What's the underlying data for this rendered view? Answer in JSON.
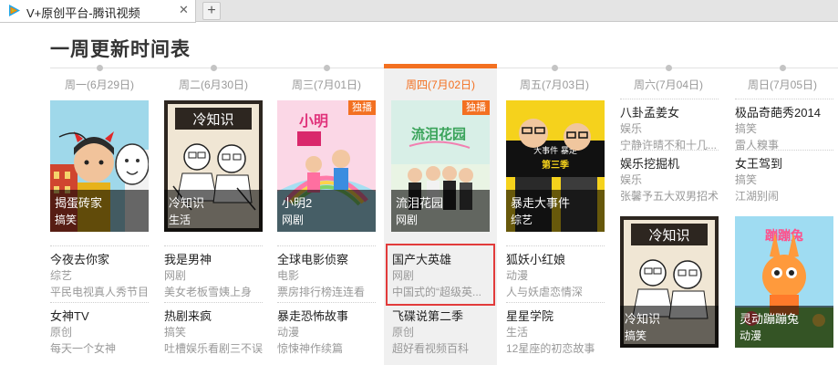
{
  "browser": {
    "tab_title": "V+原创平台-腾讯视频",
    "close_glyph": "✕",
    "newtab_glyph": "+"
  },
  "page": {
    "title": "一周更新时间表"
  },
  "colors": {
    "accent": "#f37021",
    "highlight": "#e23b3b"
  },
  "days": [
    {
      "label": "周一(6月29日)",
      "poster": {
        "title": "揭蛋砖家",
        "sub": "搞笑",
        "exclusive": ""
      },
      "entries": [
        {
          "title": "今夜去你家",
          "tag": "综艺",
          "desc": "平民电视真人秀节目"
        },
        {
          "title": "女神TV",
          "tag": "原创",
          "desc": "每天一个女神"
        }
      ]
    },
    {
      "label": "周二(6月30日)",
      "poster": {
        "title": "冷知识",
        "sub": "生活",
        "exclusive": ""
      },
      "entries": [
        {
          "title": "我是男神",
          "tag": "网剧",
          "desc": "美女老板雪姨上身"
        },
        {
          "title": "热剧来疯",
          "tag": "搞笑",
          "desc": "吐槽娱乐看剧三不误"
        }
      ]
    },
    {
      "label": "周三(7月01日)",
      "poster": {
        "title": "小明2",
        "sub": "网剧",
        "exclusive": "独播"
      },
      "entries": [
        {
          "title": "全球电影侦察",
          "tag": "电影",
          "desc": "票房排行榜连连看"
        },
        {
          "title": "暴走恐怖故事",
          "tag": "动漫",
          "desc": "惊悚神作续篇"
        }
      ]
    },
    {
      "label": "周四(7月02日)",
      "active": true,
      "poster": {
        "title": "流泪花园",
        "sub": "网剧",
        "exclusive": "独播"
      },
      "entries": [
        {
          "title": "国产大英雄",
          "tag": "网剧",
          "desc": "中国式的“超级英..."
        },
        {
          "title": "飞碟说第二季",
          "tag": "原创",
          "desc": "超好看视频百科"
        }
      ]
    },
    {
      "label": "周五(7月03日)",
      "poster": {
        "title": "暴走大事件",
        "sub": "综艺",
        "exclusive": ""
      },
      "entries": [
        {
          "title": "狐妖小红娘",
          "tag": "动漫",
          "desc": "人与妖虐恋情深"
        },
        {
          "title": "星星学院",
          "tag": "生活",
          "desc": "12星座的初恋故事"
        }
      ]
    },
    {
      "label": "周六(7月04日)",
      "entries": [
        {
          "title": "八卦孟姜女",
          "tag": "娱乐",
          "desc": "宁静许晴不和十几..."
        },
        {
          "title": "娱乐挖掘机",
          "tag": "娱乐",
          "desc": "张馨予五大双男招术"
        }
      ],
      "poster": {
        "title": "冷知识",
        "sub": "搞笑",
        "exclusive": ""
      }
    },
    {
      "label": "周日(7月05日)",
      "entries": [
        {
          "title": "极品奇葩秀2014",
          "tag": "搞笑",
          "desc": "雷人糗事"
        },
        {
          "title": "女王驾到",
          "tag": "搞笑",
          "desc": "江湖别闹"
        }
      ],
      "poster": {
        "title": "灵动蹦蹦兔",
        "sub": "动漫",
        "exclusive": "",
        "logo_text": "蹦蹦兔"
      }
    }
  ]
}
